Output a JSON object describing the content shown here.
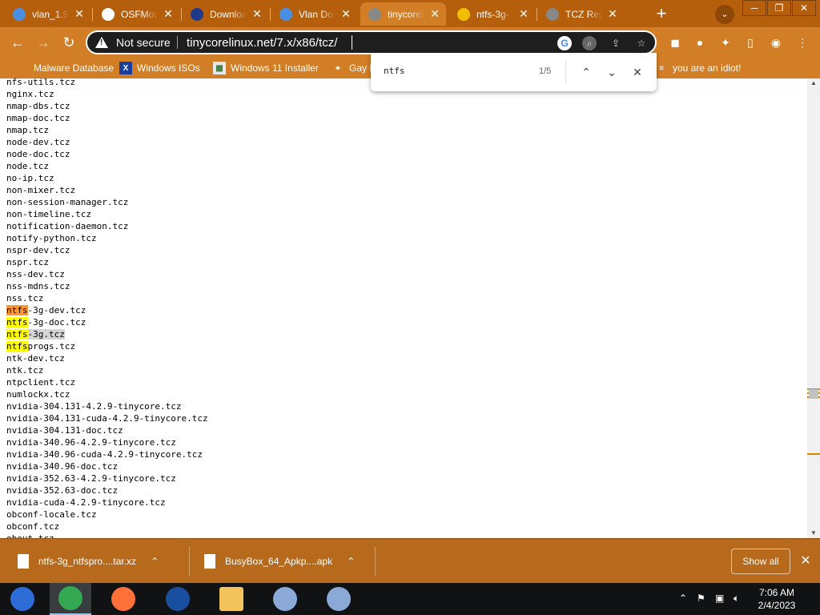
{
  "browser": {
    "tabs": [
      {
        "title": "vlan_1.9-",
        "favicon": "globe-icon",
        "color": "#4a90e2",
        "active": false
      },
      {
        "title": "OSFMoun",
        "favicon": "osfmount-icon",
        "color": "#ffffff",
        "active": false
      },
      {
        "title": "Download",
        "favicon": "sourceforge-icon",
        "color": "#1e3a8a",
        "active": false
      },
      {
        "title": "Vlan Dow",
        "favicon": "globe-icon",
        "color": "#4a90e2",
        "active": false
      },
      {
        "title": "tinycorel",
        "favicon": "tinycore-icon",
        "color": "#888888",
        "active": true
      },
      {
        "title": "ntfs-3g-",
        "favicon": "tux-icon",
        "color": "#f0c000",
        "active": false
      },
      {
        "title": "TCZ Rep",
        "favicon": "tinycore-icon",
        "color": "#888888",
        "active": false
      }
    ],
    "security_label": "Not secure",
    "url": "tinycorelinux.net/7.x/x86/tcz/",
    "bookmarks": [
      {
        "label": "Malware Database",
        "icon": "folder-icon"
      },
      {
        "label": "Windows ISOs",
        "icon": "x-icon"
      },
      {
        "label": "Windows 11 Installer",
        "icon": "image-icon"
      },
      {
        "label": "Gay H",
        "icon": "mapmarker-icon"
      },
      {
        "label": "you are an idiot!",
        "icon": "page-icon"
      }
    ]
  },
  "find": {
    "query": "ntfs",
    "count": "1/5"
  },
  "files": [
    {
      "pre": "",
      "hit": "",
      "post": "nfs-utils.tcz",
      "style": ""
    },
    {
      "pre": "",
      "hit": "",
      "post": "nginx.tcz",
      "style": ""
    },
    {
      "pre": "",
      "hit": "",
      "post": "nmap-dbs.tcz",
      "style": ""
    },
    {
      "pre": "",
      "hit": "",
      "post": "nmap-doc.tcz",
      "style": ""
    },
    {
      "pre": "",
      "hit": "",
      "post": "nmap.tcz",
      "style": ""
    },
    {
      "pre": "",
      "hit": "",
      "post": "node-dev.tcz",
      "style": ""
    },
    {
      "pre": "",
      "hit": "",
      "post": "node-doc.tcz",
      "style": ""
    },
    {
      "pre": "",
      "hit": "",
      "post": "node.tcz",
      "style": ""
    },
    {
      "pre": "",
      "hit": "",
      "post": "no-ip.tcz",
      "style": ""
    },
    {
      "pre": "",
      "hit": "",
      "post": "non-mixer.tcz",
      "style": ""
    },
    {
      "pre": "",
      "hit": "",
      "post": "non-session-manager.tcz",
      "style": ""
    },
    {
      "pre": "",
      "hit": "",
      "post": "non-timeline.tcz",
      "style": ""
    },
    {
      "pre": "",
      "hit": "",
      "post": "notification-daemon.tcz",
      "style": ""
    },
    {
      "pre": "",
      "hit": "",
      "post": "notify-python.tcz",
      "style": ""
    },
    {
      "pre": "",
      "hit": "",
      "post": "nspr-dev.tcz",
      "style": ""
    },
    {
      "pre": "",
      "hit": "",
      "post": "nspr.tcz",
      "style": ""
    },
    {
      "pre": "",
      "hit": "",
      "post": "nss-dev.tcz",
      "style": ""
    },
    {
      "pre": "",
      "hit": "",
      "post": "nss-mdns.tcz",
      "style": ""
    },
    {
      "pre": "",
      "hit": "",
      "post": "nss.tcz",
      "style": ""
    },
    {
      "pre": "",
      "hit": "ntfs",
      "post": "-3g-dev.tcz",
      "style": "active"
    },
    {
      "pre": "",
      "hit": "ntfs",
      "post": "-3g-doc.tcz",
      "style": "match"
    },
    {
      "pre": "",
      "hit": "ntfs",
      "post": "-3g.tcz",
      "style": "selected"
    },
    {
      "pre": "",
      "hit": "ntfs",
      "post": "progs.tcz",
      "style": "match"
    },
    {
      "pre": "",
      "hit": "",
      "post": "ntk-dev.tcz",
      "style": ""
    },
    {
      "pre": "",
      "hit": "",
      "post": "ntk.tcz",
      "style": ""
    },
    {
      "pre": "",
      "hit": "",
      "post": "ntpclient.tcz",
      "style": ""
    },
    {
      "pre": "",
      "hit": "",
      "post": "numlockx.tcz",
      "style": ""
    },
    {
      "pre": "",
      "hit": "",
      "post": "nvidia-304.131-4.2.9-tinycore.tcz",
      "style": ""
    },
    {
      "pre": "",
      "hit": "",
      "post": "nvidia-304.131-cuda-4.2.9-tinycore.tcz",
      "style": ""
    },
    {
      "pre": "",
      "hit": "",
      "post": "nvidia-304.131-doc.tcz",
      "style": ""
    },
    {
      "pre": "",
      "hit": "",
      "post": "nvidia-340.96-4.2.9-tinycore.tcz",
      "style": ""
    },
    {
      "pre": "",
      "hit": "",
      "post": "nvidia-340.96-cuda-4.2.9-tinycore.tcz",
      "style": ""
    },
    {
      "pre": "",
      "hit": "",
      "post": "nvidia-340.96-doc.tcz",
      "style": ""
    },
    {
      "pre": "",
      "hit": "",
      "post": "nvidia-352.63-4.2.9-tinycore.tcz",
      "style": ""
    },
    {
      "pre": "",
      "hit": "",
      "post": "nvidia-352.63-doc.tcz",
      "style": ""
    },
    {
      "pre": "",
      "hit": "",
      "post": "nvidia-cuda-4.2.9-tinycore.tcz",
      "style": ""
    },
    {
      "pre": "",
      "hit": "",
      "post": "obconf-locale.tcz",
      "style": ""
    },
    {
      "pre": "",
      "hit": "",
      "post": "obconf.tcz",
      "style": ""
    },
    {
      "pre": "",
      "hit": "",
      "post": "obout.tcz",
      "style": ""
    }
  ],
  "downloads": {
    "items": [
      {
        "name": "ntfs-3g_ntfspro....tar.xz"
      },
      {
        "name": "BusyBox_64_Apkp....apk"
      }
    ],
    "show_all_label": "Show all"
  },
  "taskbar": {
    "apps": [
      {
        "name": "store-icon",
        "color": "#2d6cd6"
      },
      {
        "name": "chrome-icon",
        "color": "#34a853"
      },
      {
        "name": "firefox-icon",
        "color": "#ff7139"
      },
      {
        "name": "obama-logo-icon",
        "color": "#1a4fa0"
      },
      {
        "name": "file-explorer-icon",
        "color": "#f3c45c"
      },
      {
        "name": "installer-icon",
        "color": "#8aa9d6"
      },
      {
        "name": "installer-icon",
        "color": "#8aa9d6"
      }
    ],
    "time": "7:06 AM",
    "date": "2/4/2023"
  },
  "colors": {
    "tab_strip": "#b55f0c",
    "toolbar": "#d27e26",
    "highlight_active": "#ff9632",
    "highlight_match": "#ffff00"
  }
}
